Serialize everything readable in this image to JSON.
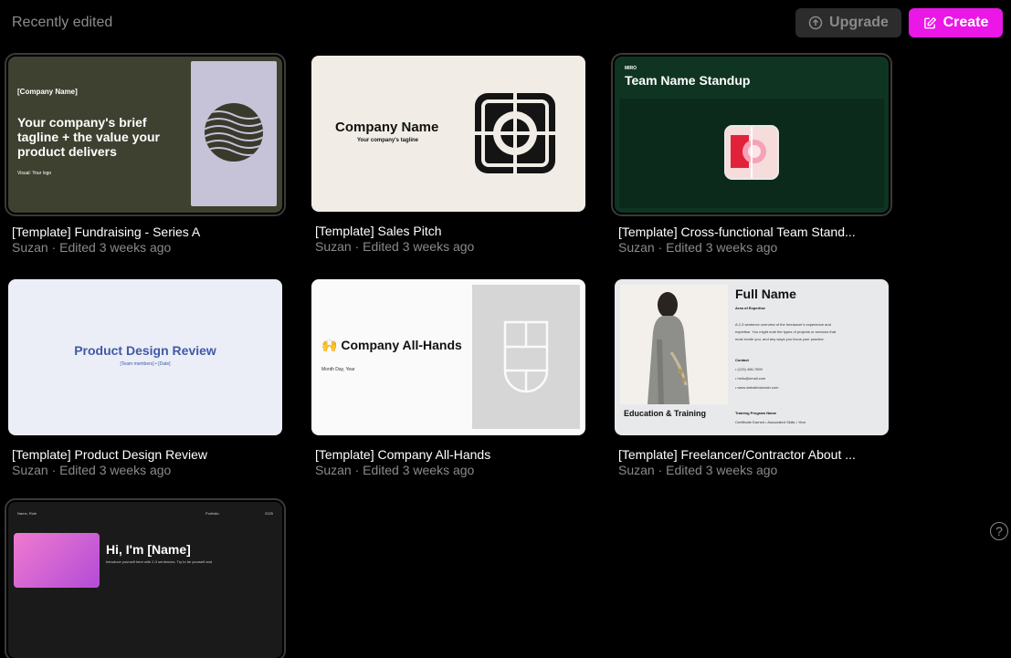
{
  "header": {
    "section_title": "Recently edited",
    "upgrade_label": "Upgrade",
    "create_label": "Create"
  },
  "cards": [
    {
      "title": "[Template] Fundraising - Series A",
      "meta": "Suzan · Edited 3 weeks ago",
      "preview": {
        "company": "[Company Name]",
        "headline1": "Your company's brief",
        "headline2": "tagline + the value your",
        "headline3": "product delivers",
        "footer": "Visual: Your logo"
      }
    },
    {
      "title": "[Template] Sales Pitch",
      "meta": "Suzan · Edited 3 weeks ago",
      "preview": {
        "company": "Company Name",
        "tagline": "Your company's tagline"
      }
    },
    {
      "title": "[Template] Cross-functional Team Stand...",
      "meta": "Suzan · Edited 3 weeks ago",
      "preview": {
        "small": "MIRO",
        "heading": "Team Name Standup"
      }
    },
    {
      "title": "[Template] Product Design Review",
      "meta": "Suzan · Edited 3 weeks ago",
      "preview": {
        "heading": "Product Design Review",
        "sub": "[Team members] • [Date]"
      }
    },
    {
      "title": "[Template] Company All-Hands",
      "meta": "Suzan · Edited 3 weeks ago",
      "preview": {
        "emoji": "🙌",
        "heading": "Company All-Hands",
        "date": "Month Day, Year"
      }
    },
    {
      "title": "[Template] Freelancer/Contractor About ...",
      "meta": "Suzan · Edited 3 weeks ago",
      "preview": {
        "name": "Full Name",
        "area": "Area of Expertise",
        "bio1": "A 2-3 sentence overview of the freelancer's experience and",
        "bio2": "expertise. You might note the types of projects or services that",
        "bio3": "most excite you, and any ways you focus your practice.",
        "contact": "Contact",
        "phone": "(123) 456-7890",
        "email": "hello@email.com",
        "website": "www.websitedomain.com",
        "education": "Education & Training",
        "program": "Training Program Name",
        "cert": "Certificate Earned • Associated Skills • Year"
      }
    },
    {
      "preview": {
        "left": "Name, Role",
        "mid": "Portfolio",
        "right": "2025",
        "heading": "Hi, I'm [Name]",
        "body": "Introduce yourself here with 2-3 sentences. Try to be yourself and"
      }
    }
  ],
  "icons": {
    "upgrade": "arrow-up-circle-icon",
    "create": "edit-square-icon",
    "help": "help-circle-icon"
  },
  "colors": {
    "accent": "#ea17e6",
    "background": "#000000"
  }
}
